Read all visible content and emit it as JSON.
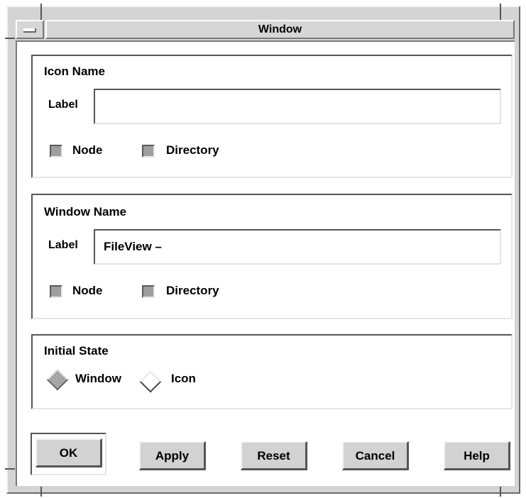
{
  "window": {
    "title": "Window"
  },
  "icon_name": {
    "title": "Icon Name",
    "label": "Label",
    "value": "",
    "checkboxes": [
      {
        "label": "Node"
      },
      {
        "label": "Directory"
      }
    ]
  },
  "window_name": {
    "title": "Window Name",
    "label": "Label",
    "value": "FileView –",
    "checkboxes": [
      {
        "label": "Node"
      },
      {
        "label": "Directory"
      }
    ]
  },
  "initial_state": {
    "title": "Initial State",
    "options": [
      {
        "label": "Window",
        "selected": true
      },
      {
        "label": "Icon",
        "selected": false
      }
    ]
  },
  "buttons": {
    "ok": "OK",
    "apply": "Apply",
    "reset": "Reset",
    "cancel": "Cancel",
    "help": "Help"
  }
}
